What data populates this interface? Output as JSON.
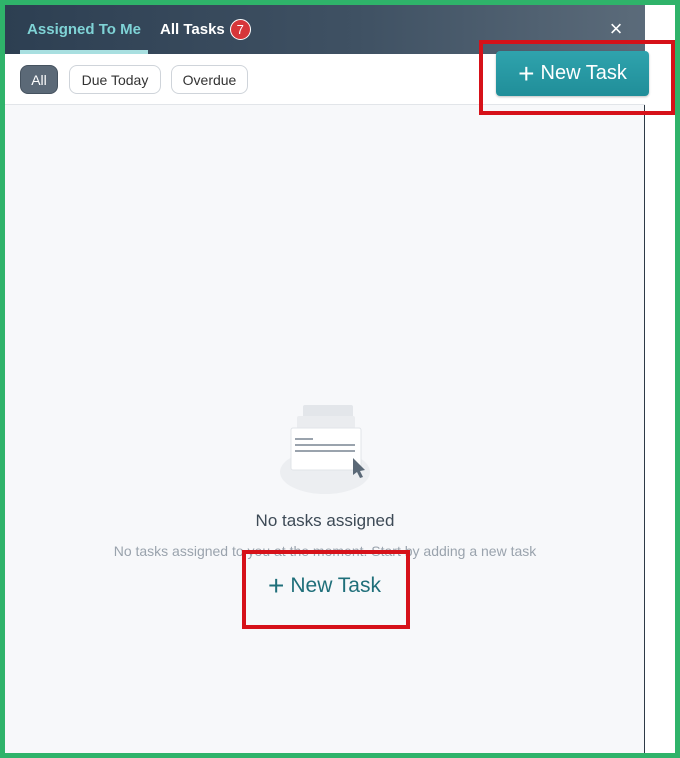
{
  "tabs": [
    {
      "label": "Assigned To Me",
      "active": true
    },
    {
      "label": "All Tasks",
      "badge": "7"
    }
  ],
  "close_glyph": "×",
  "filters": [
    {
      "label": "All",
      "selected": true
    },
    {
      "label": "Due Today"
    },
    {
      "label": "Overdue"
    }
  ],
  "new_task_label": "New Task",
  "empty_state": {
    "title": "No tasks assigned",
    "subtitle": "No tasks assigned to you at the moment. Start by adding a new task"
  },
  "colors": {
    "accent": "#2a9aa4",
    "highlight": "#d61119",
    "frame": "#2fb36a",
    "badge": "#d6363a"
  },
  "icons": [
    "close-icon",
    "plus-icon",
    "empty-tasks-illustration-icon"
  ]
}
